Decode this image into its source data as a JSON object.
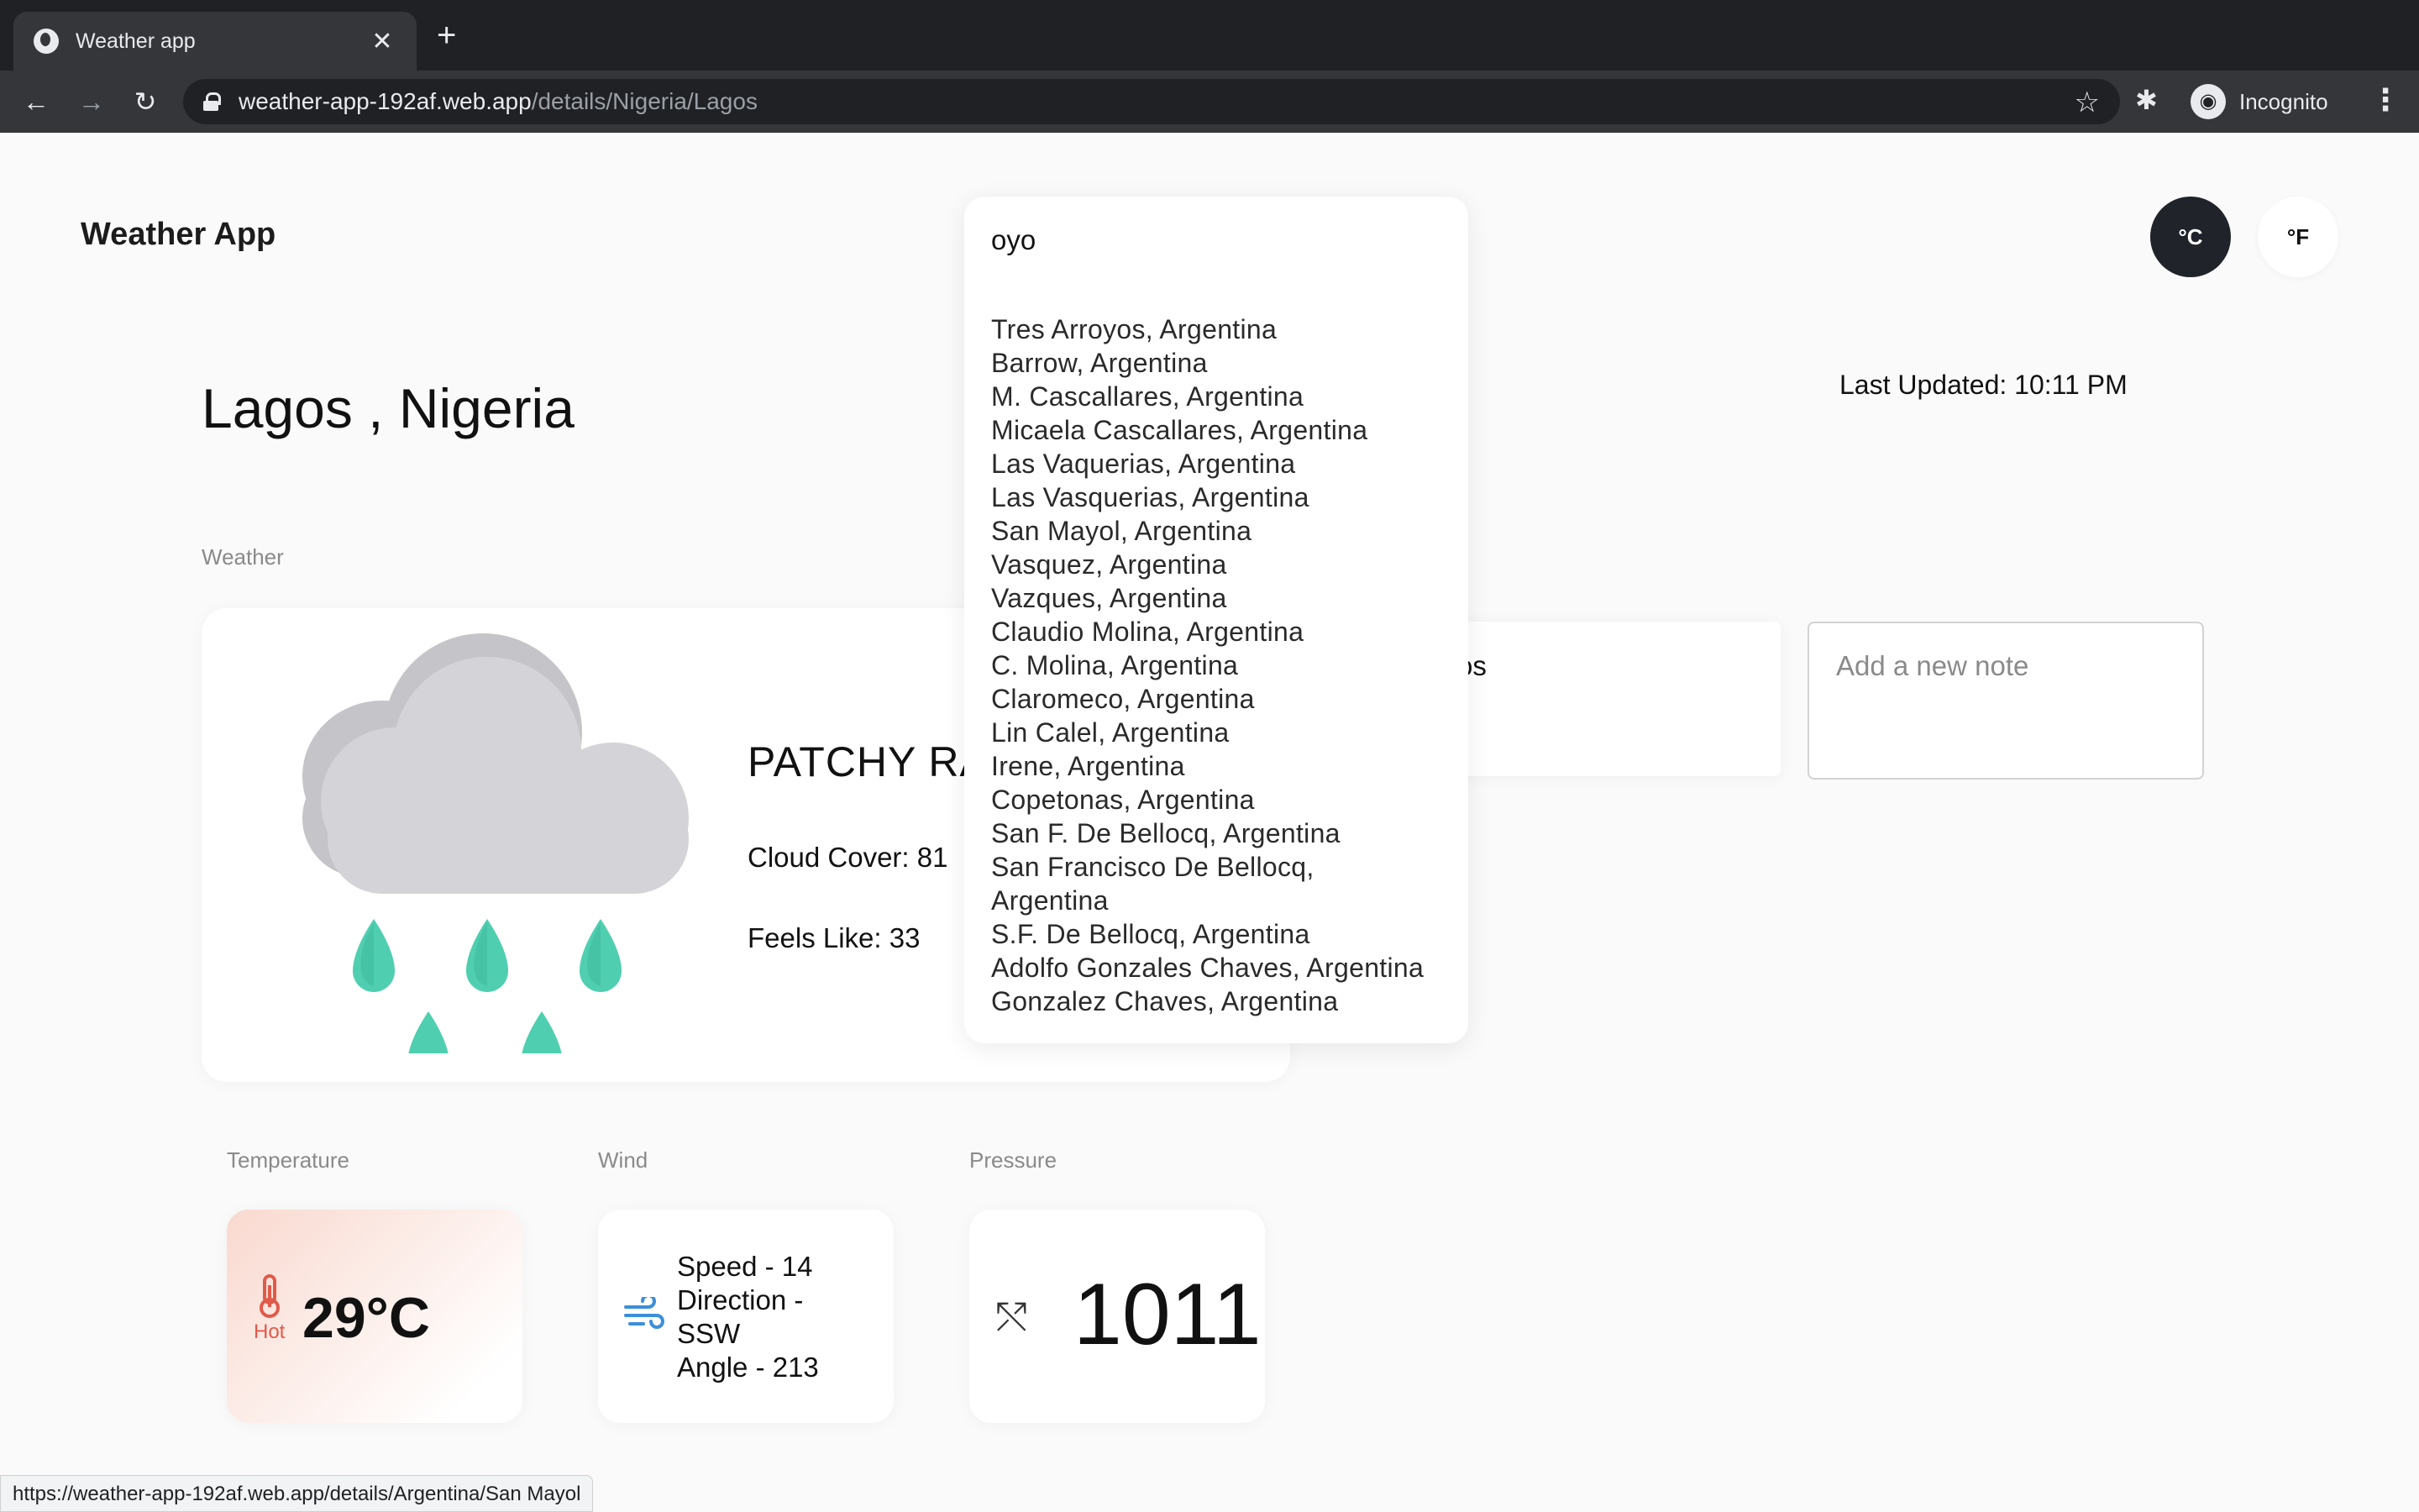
{
  "browser": {
    "tab_title": "Weather app",
    "tab_close": "✕",
    "new_tab": "+",
    "url_host": "weather-app-192af.web.app",
    "url_path": "/details/Nigeria/Lagos",
    "profile_label": "Incognito",
    "status_url": "https://weather-app-192af.web.app/details/Argentina/San Mayol"
  },
  "header": {
    "app_title": "Weather App",
    "unit_celsius": "°C",
    "unit_fahrenheit": "°F"
  },
  "location": {
    "title": "Lagos , Nigeria",
    "last_updated": "Last Updated: 10:11 PM"
  },
  "weather": {
    "section_label": "Weather",
    "condition": "PATCHY RAIN POSSIBLE",
    "cloud_cover": "Cloud Cover: 81",
    "feels_like": "Feels Like: 33"
  },
  "temperature": {
    "section_label": "Temperature",
    "badge": "Hot",
    "value": "29°C"
  },
  "wind": {
    "section_label": "Wind",
    "speed": "Speed - 14",
    "direction": "Direction - SSW",
    "angle": "Angle - 213"
  },
  "pressure": {
    "section_label": "Pressure",
    "value": "1011"
  },
  "notes": {
    "saved_note": "Lagos",
    "new_note_placeholder": "Add a new note"
  },
  "search": {
    "query": "oyo",
    "results": [
      "Tres Arroyos, Argentina",
      "Barrow, Argentina",
      "M. Cascallares, Argentina",
      "Micaela Cascallares, Argentina",
      "Las Vaquerias, Argentina",
      "Las Vasquerias, Argentina",
      "San Mayol, Argentina",
      "Vasquez, Argentina",
      "Vazques, Argentina",
      "Claudio Molina, Argentina",
      "C. Molina, Argentina",
      "Claromeco, Argentina",
      "Lin Calel, Argentina",
      "Irene, Argentina",
      "Copetonas, Argentina",
      "San F. De Bellocq, Argentina",
      "San Francisco De Bellocq, Argentina",
      "S.F. De Bellocq, Argentina",
      "Adolfo Gonzales Chaves, Argentina",
      "Gonzalez Chaves, Argentina"
    ]
  },
  "colors": {
    "dark_button": "#20232a",
    "raindrop": "#4fcfb0",
    "cloud": "#d4d4d8",
    "hot_accent": "#e05a4a",
    "wind_icon": "#3b8fd9"
  }
}
